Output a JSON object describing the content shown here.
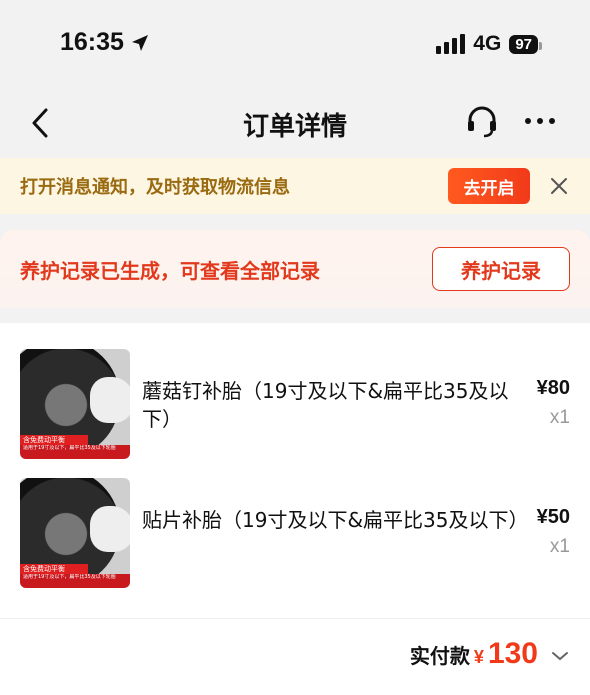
{
  "status": {
    "time": "16:35",
    "network": "4G",
    "battery": "97"
  },
  "nav": {
    "title": "订单详情"
  },
  "notification": {
    "text": "打开消息通知，及时获取物流信息",
    "button": "去开启"
  },
  "maintenance": {
    "text": "养护记录已生成，可查看全部记录",
    "button": "养护记录"
  },
  "items": [
    {
      "name": "蘑菇钉补胎（19寸及以下&扁平比35及以下）",
      "price": "¥80",
      "qty": "x1",
      "thumb_tag": "含免费动平衡",
      "thumb_note": "适用于19寸及以下，扁平比35及以下轮胎"
    },
    {
      "name": "贴片补胎（19寸及以下&扁平比35及以下）",
      "price": "¥50",
      "qty": "x1",
      "thumb_tag": "含免费动平衡",
      "thumb_note": "适用于19寸及以下，扁平比35及以下轮胎"
    }
  ],
  "total": {
    "label": "实付款",
    "currency": "¥",
    "value": "130"
  },
  "colors": {
    "accent": "#f03a1a",
    "notice_text": "#9a6a11",
    "notice_bg": "#fdf6e3"
  }
}
